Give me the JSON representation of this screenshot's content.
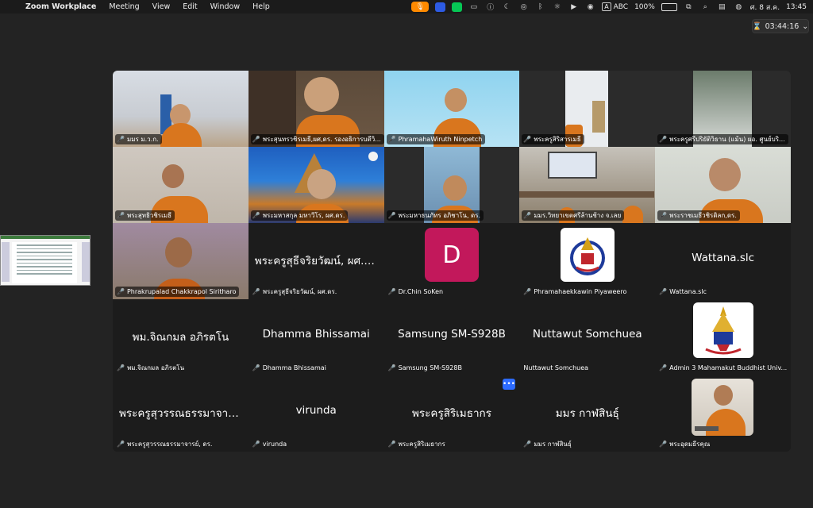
{
  "menubar": {
    "app_name": "Zoom Workplace",
    "items": [
      "Meeting",
      "View",
      "Edit",
      "Window",
      "Help"
    ],
    "input_source_letter": "A",
    "input_source": "ABC",
    "battery_percent": "100%",
    "date": "ศ. 8 ส.ค.",
    "time": "13:45"
  },
  "meeting": {
    "timer": "03:44:16"
  },
  "participants": [
    {
      "name": "มมร ม.ว.ก.",
      "type": "video"
    },
    {
      "name": "พระสุนทรวชิรเมธี,ผศ,ดร. รองอธิการบดีวิ...",
      "type": "video"
    },
    {
      "name": "PhramahaWiruth Ninpetch",
      "type": "video"
    },
    {
      "name": "พระครูสิริสารเมธี",
      "type": "video"
    },
    {
      "name": "พระครูศรีปริยัติวิธาน (แม้น) ผอ. ศูนย์บริ...",
      "type": "video"
    },
    {
      "name": "พระสุทธิวชิรเมธี",
      "type": "video"
    },
    {
      "name": "พระมหาสกุล มหาวีโร, ผศ.ดร.",
      "type": "video"
    },
    {
      "name": "พระมหาธนภัทร อภิชาโน, ดร.",
      "type": "video"
    },
    {
      "name": "มมร.วิทยาเขตศรีล้านช้าง จ.เลย",
      "type": "video"
    },
    {
      "name": "พระราชเมธีวชิรดิลก,ดร.",
      "type": "video"
    },
    {
      "name": "Phrakrupalad Chakkrapol Siritharo",
      "type": "video"
    },
    {
      "name": "พระครูสุธีจริยวัฒน์, ผศ.ดร.",
      "display": "พระครูสุธีจริยวัฒน์, ผศ.ดร.",
      "type": "name"
    },
    {
      "name": "Dr.Chin SoKen",
      "initial": "D",
      "type": "avatar"
    },
    {
      "name": "Phramahaekkawin Piyaweero",
      "type": "logo"
    },
    {
      "name": "Wattana.slc",
      "display": "Wattana.slc",
      "type": "name"
    },
    {
      "name": "พม.จิณกมล อภิรตโน",
      "display": "พม.จิณกมล อภิรตโน",
      "type": "name"
    },
    {
      "name": "Dhamma Bhissamai",
      "display": "Dhamma Bhissamai",
      "type": "name"
    },
    {
      "name": "Samsung SM-S928B",
      "display": "Samsung SM-S928B",
      "type": "name"
    },
    {
      "name": "Nuttawut Somchuea",
      "display": "Nuttawut Somchuea",
      "type": "name",
      "unmuted": true
    },
    {
      "name": "Admin 3 Mahamakut Buddhist Univ...",
      "type": "logo"
    },
    {
      "name": "พระครูสุวรรณธรรมาจารย์, ดร.",
      "display": "พระครูสุวรรณธรรมาจารย์, ดร.",
      "type": "name"
    },
    {
      "name": "virunda",
      "display": "virunda",
      "type": "name"
    },
    {
      "name": "พระครูสิริเมธากร",
      "display": "พระครูสิริเมธากร",
      "type": "name"
    },
    {
      "name": "มมร กาฬสินธุ์",
      "display": "มมร กาฬสินธุ์",
      "type": "name"
    },
    {
      "name": "พระอุดมธีรคุณ",
      "type": "video"
    }
  ],
  "colors": {
    "accent": "#2d6bff",
    "muted": "#e5484d",
    "avatar": "#c2185b",
    "robe": "#d9761e"
  }
}
